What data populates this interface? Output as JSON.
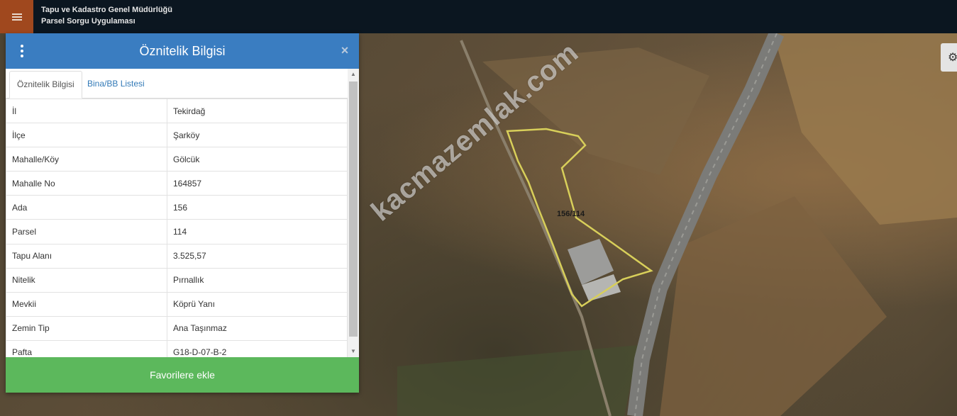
{
  "header": {
    "title_line1": "Tapu ve Kadastro Genel Müdürlüğü",
    "title_line2": "Parsel Sorgu Uygulaması"
  },
  "map": {
    "watermark": "kacmazemlak.com",
    "parcel_label": "156/114"
  },
  "panel": {
    "title": "Öznitelik Bilgisi",
    "close_glyph": "×",
    "tabs": [
      {
        "label": "Öznitelik Bilgisi",
        "active": true
      },
      {
        "label": "Bina/BB Listesi",
        "active": false
      }
    ],
    "rows": [
      {
        "key": "İl",
        "value": "Tekirdağ"
      },
      {
        "key": "İlçe",
        "value": "Şarköy"
      },
      {
        "key": "Mahalle/Köy",
        "value": "Gölcük"
      },
      {
        "key": "Mahalle No",
        "value": "164857"
      },
      {
        "key": "Ada",
        "value": "156"
      },
      {
        "key": "Parsel",
        "value": "114"
      },
      {
        "key": "Tapu Alanı",
        "value": "3.525,57"
      },
      {
        "key": "Nitelik",
        "value": "Pırnallık"
      },
      {
        "key": "Mevkii",
        "value": "Köprü Yanı"
      },
      {
        "key": "Zemin Tip",
        "value": "Ana Taşınmaz"
      },
      {
        "key": "Pafta",
        "value": "G18-D-07-B-2"
      }
    ],
    "favorite_button": "Favorilere ekle"
  },
  "icons": {
    "menu": "menu-icon",
    "kebab": "kebab-menu-icon",
    "close": "close-icon",
    "settings": "gear-icon"
  },
  "colors": {
    "header_bar": "#0b1620",
    "menu_button": "#a0481e",
    "panel_header": "#3a7dc1",
    "favorite_button": "#5cb85c",
    "parcel_outline": "#d8cf5a"
  }
}
